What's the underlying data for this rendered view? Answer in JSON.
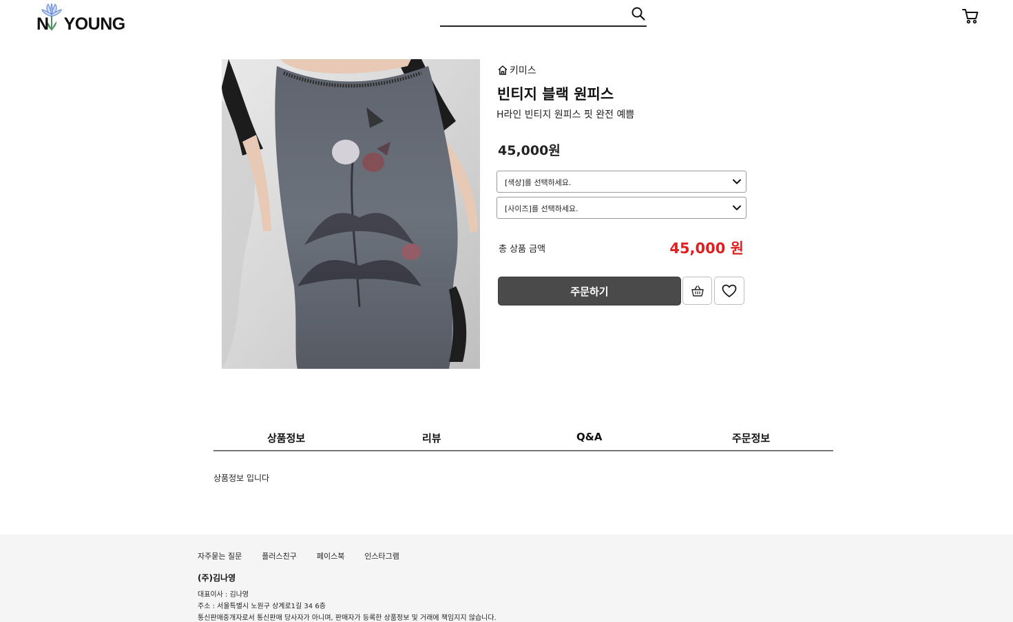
{
  "header": {
    "logo_text_left": "N",
    "logo_text_right": "YOUNG",
    "search_placeholder": "",
    "search_value": ""
  },
  "product": {
    "brand": "키미스",
    "title": "빈티지 블랙 원피스",
    "subtitle": "H라인 빈티지 원피스 핏 완전 예쁨",
    "price": "45,000원",
    "options": [
      {
        "label": "[색상]를 선택하세요."
      },
      {
        "label": "[사이즈]를 선택하세요."
      }
    ],
    "total_label": "총 상품 금액",
    "total_price": "45,000 원",
    "order_label": "주문하기"
  },
  "tabs": [
    {
      "label": "상품정보"
    },
    {
      "label": "리뷰"
    },
    {
      "label": "Q&A"
    },
    {
      "label": "주문정보"
    }
  ],
  "tab_content": "상품정보 입니다",
  "footer": {
    "links": [
      {
        "label": "자주묻는 질문"
      },
      {
        "label": "플러스친구"
      },
      {
        "label": "페이스북"
      },
      {
        "label": "인스타그램"
      }
    ],
    "company": "(주)김나영",
    "ceo": "대표이사 : 김나영",
    "address": "주소 : 서울특별시 노원구 상계로1길 34 6층",
    "notice": "통신판매중개자로서 통신판매 당사자가 아니며, 판매자가 등록한 상품정보 및 거래에 책임지지 않습니다."
  },
  "colors": {
    "accent_price": "#e02020",
    "order_button": "#4a4a4a",
    "footer_bg": "#f5f5f5"
  },
  "icons": [
    "flower-logo-icon",
    "search-icon",
    "cart-icon",
    "home-icon",
    "chevron-down-icon",
    "basket-icon",
    "heart-icon"
  ]
}
